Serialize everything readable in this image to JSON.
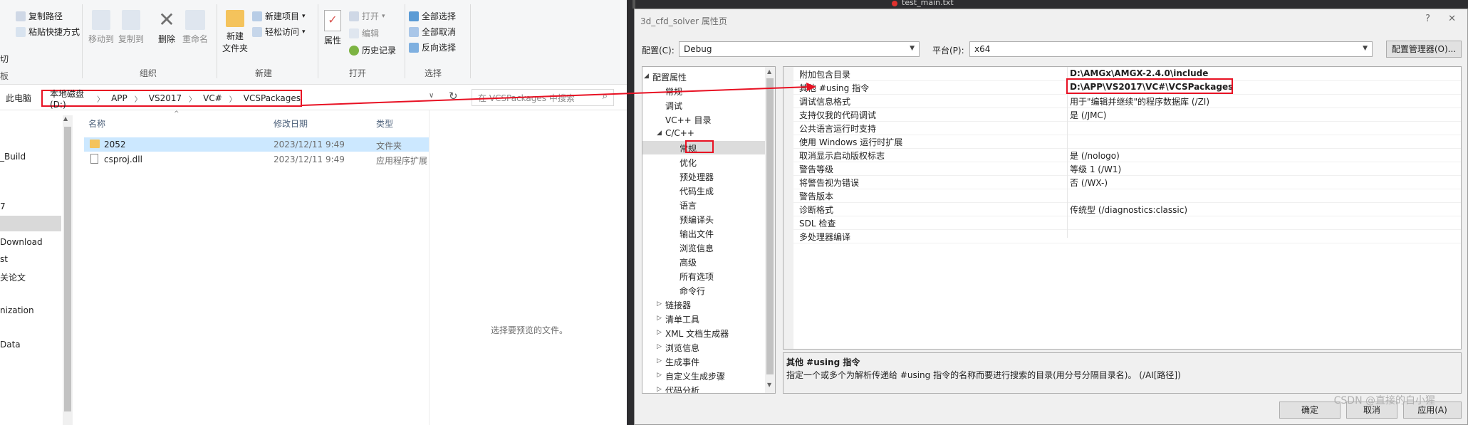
{
  "explorer": {
    "ribbon": {
      "clipboard": {
        "copy_path": "复制路径",
        "paste_shortcut": "粘贴快捷方式",
        "clip_partial": "切",
        "clip_group_partial": "板"
      },
      "organize": {
        "move_to": "移动到",
        "copy_to": "复制到",
        "delete": "删除",
        "rename": "重命名",
        "group": "组织"
      },
      "new": {
        "new_folder": "新建\n文件夹",
        "new_item": "新建项目",
        "easy_access": "轻松访问",
        "group": "新建"
      },
      "open": {
        "properties": "属性",
        "open": "打开",
        "edit": "编辑",
        "history": "历史记录",
        "group": "打开"
      },
      "select": {
        "select_all": "全部选择",
        "select_none": "全部取消",
        "invert": "反向选择",
        "group": "选择"
      }
    },
    "address": {
      "root": "此电脑",
      "crumbs": [
        "本地磁盘 (D:)",
        "APP",
        "VS2017",
        "VC#",
        "VCSPackages"
      ],
      "search_placeholder": "在 VCSPackages 中搜索"
    },
    "nav_items": [
      "_Build",
      "7",
      "Download",
      "st",
      "关论文",
      "nization",
      "Data"
    ],
    "columns": {
      "name": "名称",
      "modified": "修改日期",
      "type": "类型"
    },
    "files": [
      {
        "name": "2052",
        "modified": "2023/12/11 9:49",
        "type": "文件夹",
        "icon": "folder-icon"
      },
      {
        "name": "csproj.dll",
        "modified": "2023/12/11 9:49",
        "type": "应用程序扩展",
        "icon": "dll-file-icon"
      }
    ],
    "preview_text": "选择要预览的文件。"
  },
  "vs_tab": {
    "label": "test_main.txt"
  },
  "dialog": {
    "title": "3d_cfd_solver 属性页",
    "help": "?",
    "close": "✕",
    "config_label": "配置(C):",
    "config_value": "Debug",
    "platform_label": "平台(P):",
    "platform_value": "x64",
    "config_manager": "配置管理器(O)...",
    "tree": [
      {
        "label": "配置属性",
        "level": 0,
        "arrow": "◢"
      },
      {
        "label": "常规",
        "level": 1
      },
      {
        "label": "调试",
        "level": 1
      },
      {
        "label": "VC++ 目录",
        "level": 1
      },
      {
        "label": "C/C++",
        "level": 1,
        "arrow": "◢"
      },
      {
        "label": "常规",
        "level": 2,
        "selected": true
      },
      {
        "label": "优化",
        "level": 2
      },
      {
        "label": "预处理器",
        "level": 2
      },
      {
        "label": "代码生成",
        "level": 2
      },
      {
        "label": "语言",
        "level": 2
      },
      {
        "label": "预编译头",
        "level": 2
      },
      {
        "label": "输出文件",
        "level": 2
      },
      {
        "label": "浏览信息",
        "level": 2
      },
      {
        "label": "高级",
        "level": 2
      },
      {
        "label": "所有选项",
        "level": 2
      },
      {
        "label": "命令行",
        "level": 2
      },
      {
        "label": "链接器",
        "level": 1,
        "arrow": "▷"
      },
      {
        "label": "清单工具",
        "level": 1,
        "arrow": "▷"
      },
      {
        "label": "XML 文档生成器",
        "level": 1,
        "arrow": "▷"
      },
      {
        "label": "浏览信息",
        "level": 1,
        "arrow": "▷"
      },
      {
        "label": "生成事件",
        "level": 1,
        "arrow": "▷"
      },
      {
        "label": "自定义生成步骤",
        "level": 1,
        "arrow": "▷"
      },
      {
        "label": "代码分析",
        "level": 1,
        "arrow": "▷"
      }
    ],
    "properties": [
      {
        "name": "附加包含目录",
        "value": "D:\\AMGx\\AMGX-2.4.0\\include",
        "bold": true
      },
      {
        "name": "其他 #using 指令",
        "value": "D:\\APP\\VS2017\\VC#\\VCSPackages",
        "bold": true
      },
      {
        "name": "调试信息格式",
        "value": "用于\"编辑并继续\"的程序数据库 (/ZI)"
      },
      {
        "name": "支持仅我的代码调试",
        "value": "是 (/JMC)"
      },
      {
        "name": "公共语言运行时支持",
        "value": ""
      },
      {
        "name": "使用 Windows 运行时扩展",
        "value": ""
      },
      {
        "name": "取消显示启动版权标志",
        "value": "是 (/nologo)"
      },
      {
        "name": "警告等级",
        "value": "等级 1 (/W1)"
      },
      {
        "name": "将警告视为错误",
        "value": "否 (/WX-)"
      },
      {
        "name": "警告版本",
        "value": ""
      },
      {
        "name": "诊断格式",
        "value": "传统型 (/diagnostics:classic)"
      },
      {
        "name": "SDL 检查",
        "value": ""
      },
      {
        "name": "多处理器编译",
        "value": ""
      }
    ],
    "description": {
      "title": "其他 #using 指令",
      "text": "指定一个或多个为解析传递给 #using 指令的名称而要进行搜索的目录(用分号分隔目录名)。 (/AI[路径])"
    },
    "buttons": {
      "ok": "确定",
      "cancel": "取消",
      "apply": "应用(A)"
    }
  },
  "watermark": "CSDN @直接的白小猩",
  "colors": {
    "highlight": "#e81123",
    "folder": "#f4c35c",
    "selection": "#cce8ff"
  }
}
